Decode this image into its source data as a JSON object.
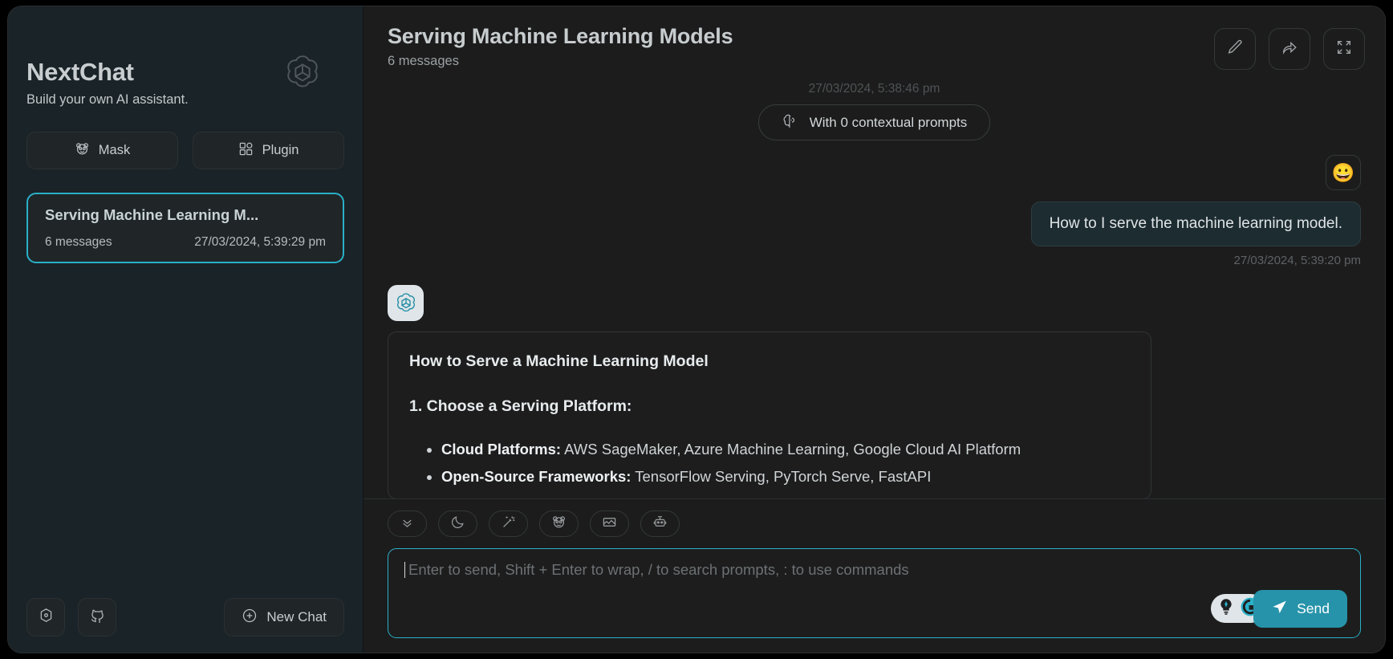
{
  "sidebar": {
    "brand_title": "NextChat",
    "brand_subtitle": "Build your own AI assistant.",
    "logo_icon": "openai-logo-icon",
    "buttons": [
      {
        "label": "Mask",
        "icon": "panda-mask-icon"
      },
      {
        "label": "Plugin",
        "icon": "grid-plugin-icon"
      }
    ],
    "chats": [
      {
        "title": "Serving Machine Learning M...",
        "message_count": "6 messages",
        "timestamp": "27/03/2024, 5:39:29 pm",
        "selected": true
      }
    ],
    "bottom": {
      "settings_icon": "settings-hex-icon",
      "github_icon": "github-icon",
      "new_chat_label": "New Chat",
      "new_chat_icon": "plus-circle-icon"
    },
    "accent": "#2ab0c9"
  },
  "header": {
    "title": "Serving Machine Learning Models",
    "subtitle": "6 messages",
    "actions": [
      {
        "name": "edit-button",
        "icon": "pencil-icon"
      },
      {
        "name": "share-button",
        "icon": "share-arrow-icon"
      },
      {
        "name": "fullscreen-button",
        "icon": "expand-icon"
      }
    ]
  },
  "conversation": {
    "system_timestamp": "27/03/2024, 5:38:46 pm",
    "context_pill": {
      "label": "With 0 contextual prompts",
      "icon": "brain-icon"
    },
    "user_message": {
      "avatar_icon": "grinning-face-avatar",
      "avatar_glyph": "😀",
      "text": "How to I serve the machine learning model.",
      "timestamp": "27/03/2024, 5:39:20 pm"
    },
    "assistant_message": {
      "avatar_icon": "openai-logo-avatar",
      "heading": "How to Serve a Machine Learning Model",
      "step_title": "1. Choose a Serving Platform:",
      "bullets": [
        {
          "term": "Cloud Platforms:",
          "detail": " AWS SageMaker, Azure Machine Learning, Google Cloud AI Platform"
        },
        {
          "term": "Open-Source Frameworks:",
          "detail": " TensorFlow Serving, PyTorch Serve, FastAPI"
        }
      ]
    }
  },
  "composer": {
    "tools": [
      {
        "name": "scroll-to-bottom-button",
        "icon": "chevrons-down-icon"
      },
      {
        "name": "theme-toggle-button",
        "icon": "moon-icon"
      },
      {
        "name": "prompt-button",
        "icon": "magic-wand-icon"
      },
      {
        "name": "mask-button",
        "icon": "panda-mask-icon"
      },
      {
        "name": "layout-button",
        "icon": "image-layout-icon"
      },
      {
        "name": "model-button",
        "icon": "robot-icon"
      }
    ],
    "input_placeholder": "Enter to send, Shift + Enter to wrap, / to search prompts, : to use commands",
    "input_value": "",
    "badges": [
      {
        "name": "gemini-badge-icon",
        "icon": "lightbulb-sparkle-icon"
      },
      {
        "name": "google-badge-icon",
        "icon": "google-g-icon"
      }
    ],
    "send_label": "Send",
    "send_icon": "send-arrow-icon",
    "send_color": "#2693aa"
  }
}
